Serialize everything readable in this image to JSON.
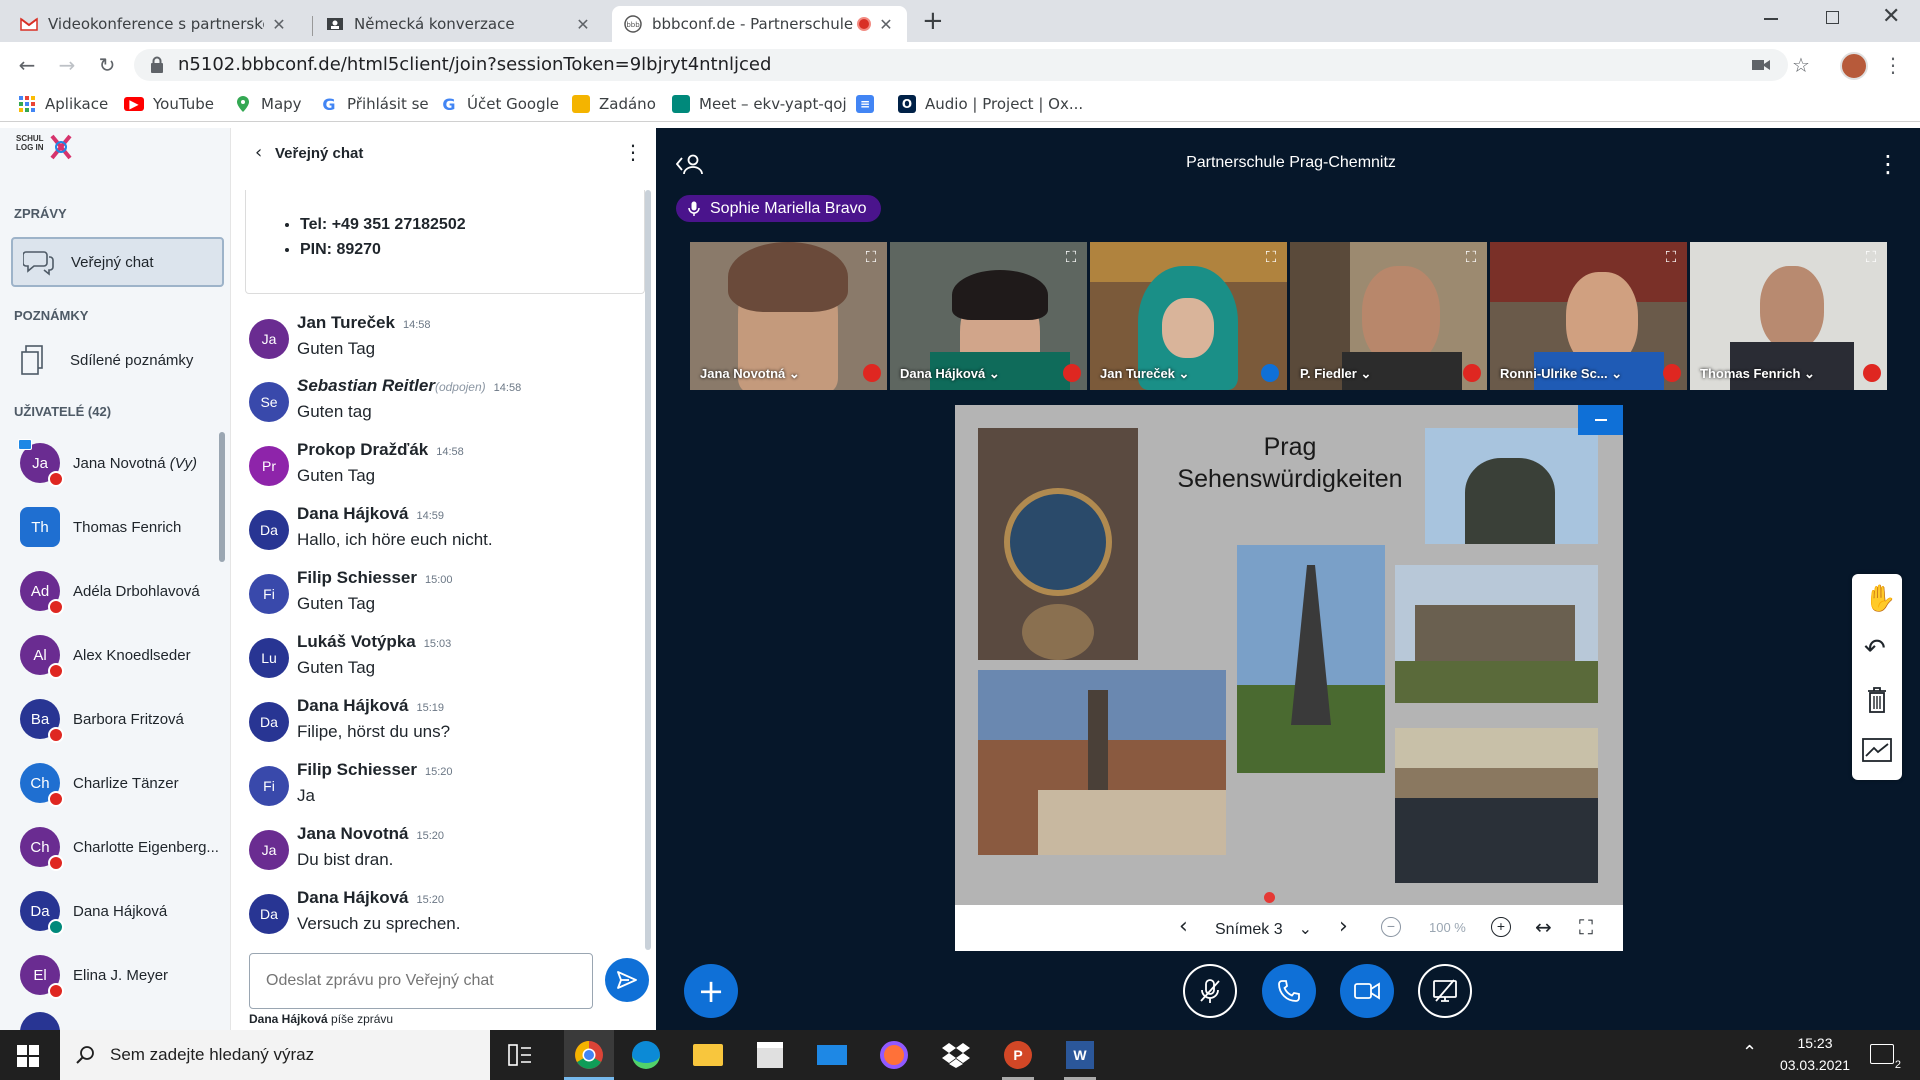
{
  "browser": {
    "tabs": [
      {
        "title": "Videokonference s partnerskou š",
        "icon": "gmail-icon"
      },
      {
        "title": "Německá konverzace",
        "icon": "classroom-icon"
      },
      {
        "title": "bbbconf.de - Partnerschule P",
        "icon": "bbb-icon",
        "active": true
      }
    ],
    "url": "n5102.bbbconf.de/html5client/join?sessionToken=9lbjryt4ntnljced",
    "bookmarks": [
      {
        "label": "Aplikace",
        "icon": "apps-grid-icon",
        "color": "#4285f4"
      },
      {
        "label": "YouTube",
        "icon": "youtube-icon",
        "color": "#ff0000"
      },
      {
        "label": "Mapy",
        "icon": "maps-pin-icon",
        "color": "#34a853"
      },
      {
        "label": "Přihlásit se",
        "icon": "google-icon",
        "color": "#4285f4"
      },
      {
        "label": "Účet Google",
        "icon": "google-icon",
        "color": "#4285f4"
      },
      {
        "label": "Zadáno",
        "icon": "classroom-icon",
        "color": "#f4b400"
      },
      {
        "label": "Meet – ekv-yapt-qoj",
        "icon": "meet-icon",
        "color": "#00897b"
      },
      {
        "label": "",
        "icon": "docs-icon",
        "color": "#4285f4"
      },
      {
        "label": "Audio | Project | Ox...",
        "icon": "oxford-icon",
        "color": "#002147"
      }
    ]
  },
  "users_panel": {
    "logo_text": "SCHUL LOG IN",
    "messages_heading": "ZPRÁVY",
    "public_chat": "Veřejný chat",
    "notes_heading": "POZNÁMKY",
    "shared_notes": "Sdílené poznámky",
    "users_heading": "UŽIVATELÉ (42)",
    "users": [
      {
        "initials": "Ja",
        "name": "Jana Novotná",
        "you": "(Vy)",
        "color": "#6a2c91",
        "muted": true
      },
      {
        "initials": "Th",
        "name": "Thomas Fenrich",
        "color": "#1f6fd1",
        "square": true
      },
      {
        "initials": "Ad",
        "name": "Adéla Drbohlavová",
        "color": "#6a2c91",
        "muted": true
      },
      {
        "initials": "Al",
        "name": "Alex Knoedlseder",
        "color": "#6a2c91",
        "muted": true
      },
      {
        "initials": "Ba",
        "name": "Barbora Fritzová",
        "color": "#283593",
        "muted": true
      },
      {
        "initials": "Ch",
        "name": "Charlize Tänzer",
        "color": "#1f6fd1",
        "muted": true
      },
      {
        "initials": "Ch",
        "name": "Charlotte Eigenberg...",
        "color": "#6a2c91",
        "muted": true
      },
      {
        "initials": "Da",
        "name": "Dana Hájková",
        "color": "#283593",
        "muted": false
      },
      {
        "initials": "El",
        "name": "Elina J. Meyer",
        "color": "#6a2c91",
        "muted": true
      }
    ]
  },
  "chat": {
    "title": "Veřejný chat",
    "pinned": [
      "Tel: +49 351 27182502",
      "PIN: 89270"
    ],
    "messages": [
      {
        "initials": "Ja",
        "name": "Jan Tureček",
        "time": "14:58",
        "text": "Guten Tag",
        "color": "#6a2c91"
      },
      {
        "initials": "Se",
        "name": "Sebastian Reitler",
        "status": "(odpojen)",
        "time": "14:58",
        "text": "Guten tag",
        "color": "#3949ab"
      },
      {
        "initials": "Pr",
        "name": "Prokop Dražďák",
        "time": "14:58",
        "text": "Guten Tag",
        "color": "#8e24aa"
      },
      {
        "initials": "Da",
        "name": "Dana Hájková",
        "time": "14:59",
        "text": "Hallo, ich höre euch nicht.",
        "color": "#283593"
      },
      {
        "initials": "Fi",
        "name": "Filip Schiesser",
        "time": "15:00",
        "text": "Guten Tag",
        "color": "#3949ab"
      },
      {
        "initials": "Lu",
        "name": "Lukáš Votýpka",
        "time": "15:03",
        "text": "Guten Tag",
        "color": "#283593"
      },
      {
        "initials": "Da",
        "name": "Dana Hájková",
        "time": "15:19",
        "text": "Filipe, hörst du uns?",
        "color": "#283593"
      },
      {
        "initials": "Fi",
        "name": "Filip Schiesser",
        "time": "15:20",
        "text": "Ja",
        "color": "#3949ab"
      },
      {
        "initials": "Ja",
        "name": "Jana Novotná",
        "time": "15:20",
        "text": "Du bist dran.",
        "color": "#6a2c91"
      },
      {
        "initials": "Da",
        "name": "Dana Hájková",
        "time": "15:20",
        "text": "Versuch zu sprechen.",
        "color": "#283593"
      }
    ],
    "input_placeholder": "Odeslat zprávu pro Veřejný chat",
    "typing_name": "Dana Hájková",
    "typing_text": "píše zprávu"
  },
  "meeting": {
    "title": "Partnerschule Prag-Chemnitz",
    "talking": "Sophie Mariella Bravo",
    "videos": [
      {
        "name": "Jana Novotná",
        "bg": "#8a7a6a",
        "face": "#c49a7c",
        "mic": "muted"
      },
      {
        "name": "Dana Hájková",
        "bg": "#5e6660",
        "face": "#d1a58a",
        "mic": "muted"
      },
      {
        "name": "Jan Tureček",
        "bg": "#7b5a3a",
        "face": "#1a8f87",
        "mic": "listen"
      },
      {
        "name": "P. Fiedler",
        "bg": "#9c8a70",
        "face": "#b8876b",
        "mic": "muted"
      },
      {
        "name": "Ronni-Ulrike Sc...",
        "bg": "#6a5a4a",
        "face": "#d0a080",
        "mic": "muted"
      },
      {
        "name": "Thomas Fenrich",
        "bg": "#dcdcd8",
        "face": "#b88a70",
        "mic": "muted"
      }
    ],
    "slide": {
      "title_line1": "Prag",
      "title_line2": "Sehenswürdigkeiten",
      "label": "Snímek 3",
      "zoom": "100 %"
    }
  },
  "taskbar": {
    "search_placeholder": "Sem zadejte hledaný výraz",
    "time": "15:23",
    "date": "03.03.2021"
  }
}
